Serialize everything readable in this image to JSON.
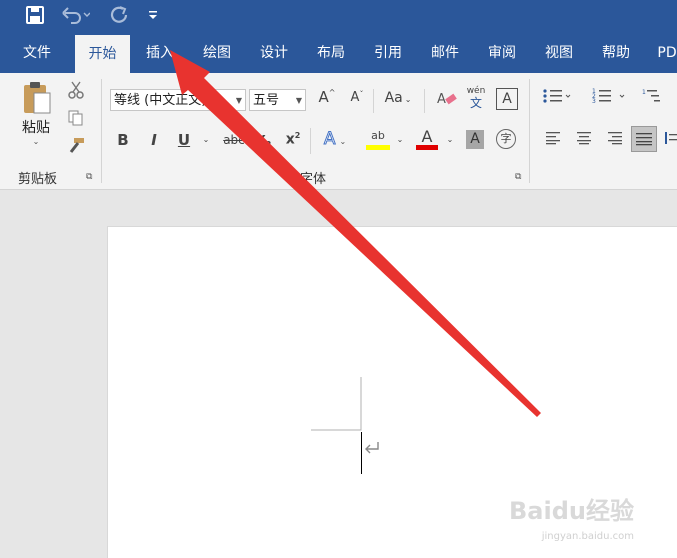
{
  "quick_access": {
    "save_icon": "save-icon",
    "undo_icon": "undo-icon",
    "redo_icon": "redo-icon",
    "customize_icon": "customize-icon"
  },
  "tabs": [
    {
      "label": "文件",
      "active": false
    },
    {
      "label": "开始",
      "active": true
    },
    {
      "label": "插入",
      "active": false
    },
    {
      "label": "绘图",
      "active": false
    },
    {
      "label": "设计",
      "active": false
    },
    {
      "label": "布局",
      "active": false
    },
    {
      "label": "引用",
      "active": false
    },
    {
      "label": "邮件",
      "active": false
    },
    {
      "label": "审阅",
      "active": false
    },
    {
      "label": "视图",
      "active": false
    },
    {
      "label": "帮助",
      "active": false
    },
    {
      "label": "PD",
      "active": false
    }
  ],
  "clipboard": {
    "paste_label": "粘贴",
    "group_label": "剪贴板"
  },
  "font": {
    "font_name": "等线 (中文正文)",
    "font_size": "五号",
    "group_label": "字体",
    "grow_glyph": "A",
    "shrink_glyph": "A",
    "case_label": "Aa",
    "bold": "B",
    "italic": "I",
    "underline": "U",
    "strike": "abc",
    "sub": "x",
    "sup": "x",
    "superscript_mark": "2",
    "subscript_mark": "2",
    "phonetic_top": "wén",
    "phonetic_bottom": "文",
    "char_border": "A",
    "text_effect": "A",
    "highlight": "ab",
    "font_color": "A",
    "char_shading": "A",
    "enclose": "字"
  },
  "colors": {
    "brand": "#2b579a",
    "highlight": "#ffff00",
    "font_color": "#e00000",
    "arrow": "#e8332f"
  },
  "watermark": {
    "text": "Baidu经验",
    "url": "jingyan.baidu.com"
  }
}
